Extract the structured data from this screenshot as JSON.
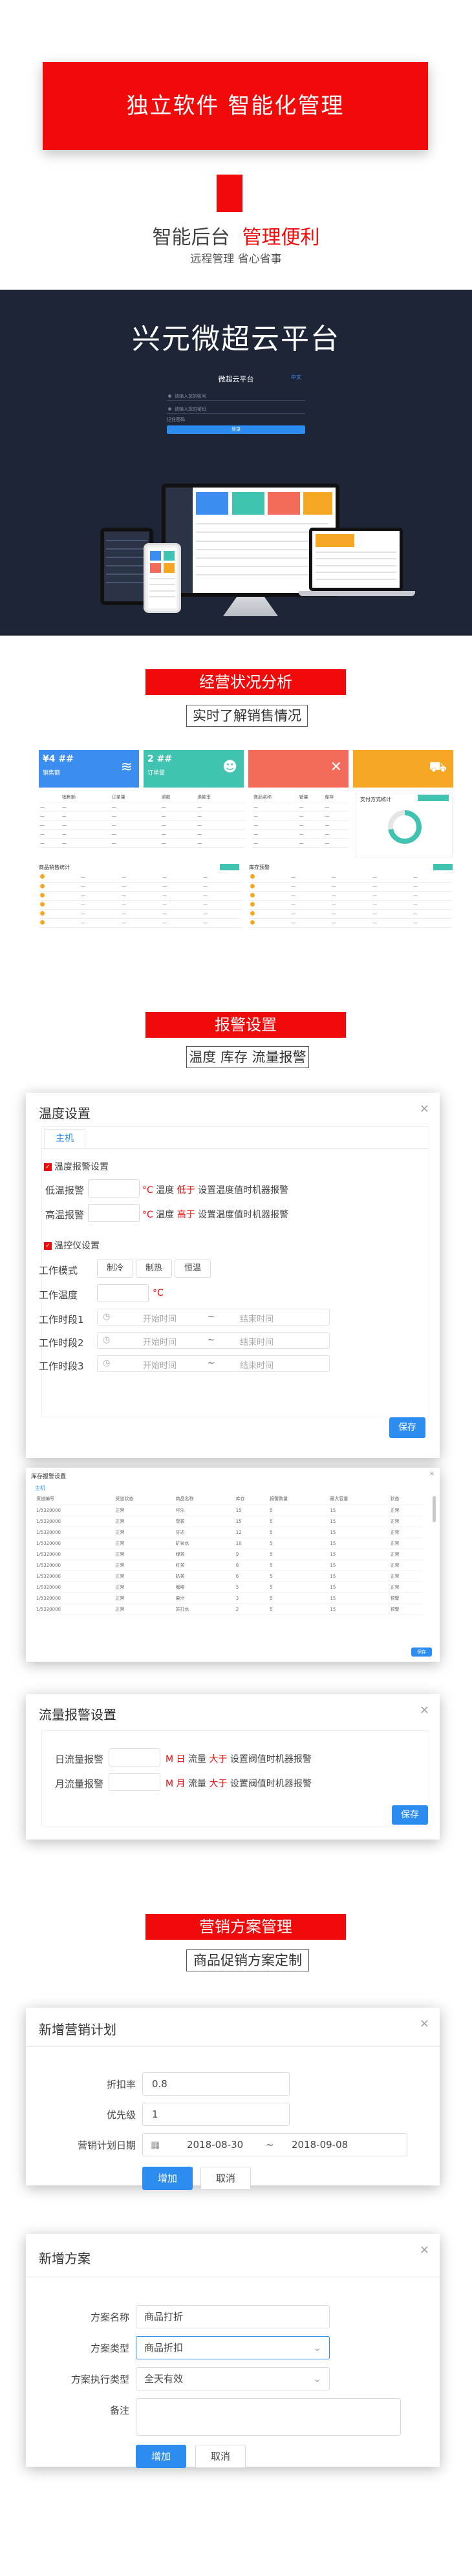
{
  "hero": {
    "banner": "独立软件 智能化管理",
    "line1_a": "智能后台",
    "line1_b": "管理便利",
    "line2": "远程管理 省心省事"
  },
  "platform": {
    "title": "兴元微超云平台",
    "login_title": "微超云平台",
    "login_tag": "中文",
    "field_user": "请输入您的账号",
    "field_pass": "请输入您的密码",
    "remember": "记住密码",
    "login_btn": "登录"
  },
  "sections": {
    "business": {
      "banner": "经营状况分析",
      "sub": "实时了解销售情况"
    },
    "alarm": {
      "banner": "报警设置",
      "sub": "温度 库存 流量报警"
    },
    "marketing": {
      "banner": "营销方案管理",
      "sub": "商品促销方案定制"
    }
  },
  "dashboard": {
    "kpis": [
      {
        "value": "¥4 ##",
        "label": "销售额",
        "color": "#3b8df0",
        "icon": "wifi-icon"
      },
      {
        "value": "2 ##",
        "label": "订单量",
        "color": "#40c4b1",
        "icon": "people-icon"
      },
      {
        "value": "",
        "label": "",
        "color": "#f36b5b",
        "icon": "tools-icon"
      },
      {
        "value": "",
        "label": "",
        "color": "#f5a623",
        "icon": "cart-icon"
      }
    ],
    "left_headers": [
      "",
      "销售额",
      "订单量",
      "退款",
      "退款率"
    ],
    "right_headers": [
      "商品名称",
      "销量",
      "库存",
      "状态",
      "售价"
    ],
    "sales_title": "商品销售统计",
    "stock_title": "库存预警",
    "chart_title": "支付方式统计"
  },
  "temp_dialog": {
    "title": "温度设置",
    "tab": "主机",
    "section1": "温度报警设置",
    "low_label": "低温报警",
    "low_unit": "°C",
    "low_note_a": "温度",
    "low_note_b": "低于",
    "low_note_c": "设置温度值时机器报警",
    "high_label": "高温报警",
    "high_unit": "°C",
    "high_note_a": "温度",
    "high_note_b": "高于",
    "high_note_c": "设置温度值时机器报警",
    "section2": "温控仪设置",
    "mode_label": "工作模式",
    "modes": [
      "制冷",
      "制热",
      "恒温"
    ],
    "temp_label": "工作温度",
    "temp_unit": "°C",
    "period1_label": "工作时段1",
    "period2_label": "工作时段2",
    "period3_label": "工作时段3",
    "start_ph": "开始时间",
    "end_ph": "结束时间",
    "sep": "~",
    "save": "保存"
  },
  "stock_card": {
    "title": "库存报警设置",
    "tab": "主机",
    "headers": [
      "货道编号",
      "货道状态",
      "商品名称",
      "库存",
      "报警数量",
      "最大容量",
      "状态"
    ],
    "rows": [
      [
        "1/5320000",
        "正常",
        "可乐",
        "15",
        "5",
        "15",
        "正常"
      ],
      [
        "1/5320000",
        "正常",
        "雪碧",
        "15",
        "5",
        "15",
        "正常"
      ],
      [
        "1/5320000",
        "正常",
        "芬达",
        "12",
        "5",
        "15",
        "正常"
      ],
      [
        "1/5320000",
        "正常",
        "矿泉水",
        "10",
        "5",
        "15",
        "正常"
      ],
      [
        "1/5320000",
        "正常",
        "绿茶",
        "9",
        "5",
        "15",
        "正常"
      ],
      [
        "1/5320000",
        "正常",
        "红茶",
        "8",
        "5",
        "15",
        "正常"
      ],
      [
        "1/5320000",
        "正常",
        "奶茶",
        "6",
        "5",
        "15",
        "正常"
      ],
      [
        "1/5320000",
        "正常",
        "咖啡",
        "5",
        "5",
        "15",
        "正常"
      ],
      [
        "1/5320000",
        "正常",
        "果汁",
        "3",
        "5",
        "15",
        "预警"
      ],
      [
        "1/5320000",
        "正常",
        "苏打水",
        "2",
        "5",
        "15",
        "预警"
      ]
    ],
    "save": "保存"
  },
  "flow_dialog": {
    "title": "流量报警设置",
    "day_label": "日流量报警",
    "day_unit": "M",
    "day_note_a": "日",
    "day_note_b": "流量",
    "day_note_c": "大于",
    "day_note_d": "设置阀值时机器报警",
    "month_label": "月流量报警",
    "month_unit": "M",
    "month_note_a": "月",
    "month_note_b": "流量",
    "month_note_c": "大于",
    "month_note_d": "设置阀值时机器报警",
    "save": "保存"
  },
  "plan_dialog": {
    "title": "新增营销计划",
    "discount_label": "折扣率",
    "discount_value": "0.8",
    "priority_label": "优先级",
    "priority_value": "1",
    "date_label": "营销计划日期",
    "date_start": "2018-08-30",
    "date_sep": "~",
    "date_end": "2018-09-08",
    "add": "增加",
    "cancel": "取消"
  },
  "scheme_dialog": {
    "title": "新增方案",
    "name_label": "方案名称",
    "name_value": "商品打折",
    "type_label": "方案类型",
    "type_value": "商品折扣",
    "exec_label": "方案执行类型",
    "exec_value": "全天有效",
    "remark_label": "备注",
    "add": "增加",
    "cancel": "取消"
  },
  "colors": {
    "brand_red": "#f00a0a",
    "primary_blue": "#2d8cf0",
    "dark_bg": "#1d2536"
  }
}
